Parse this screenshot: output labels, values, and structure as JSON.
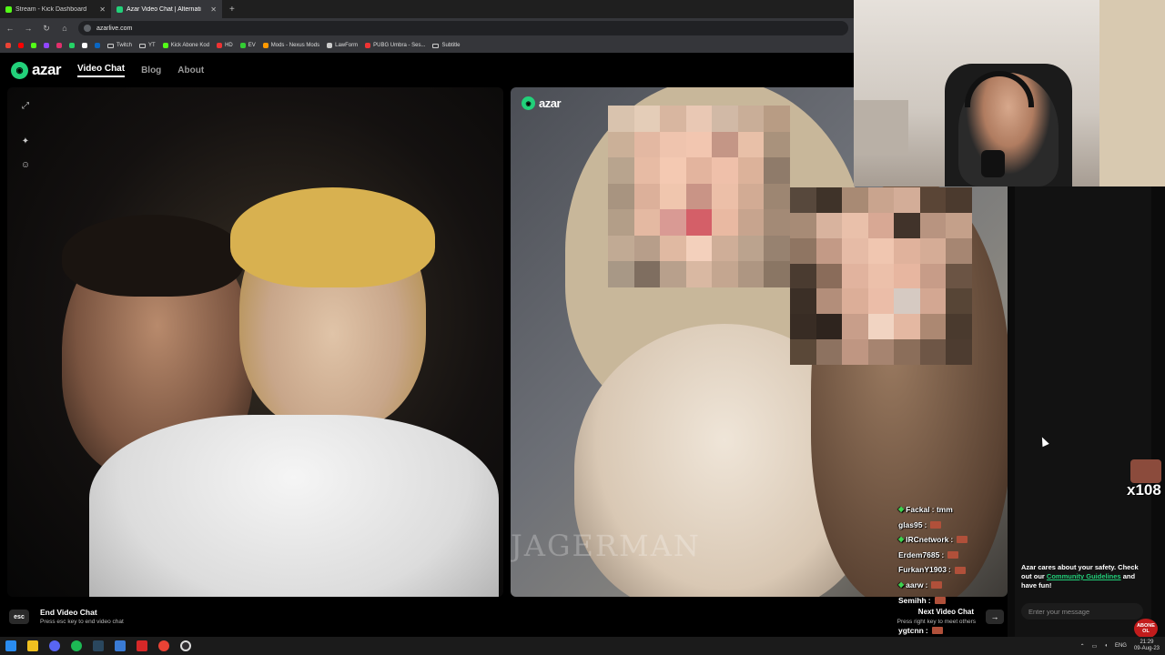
{
  "browser": {
    "tabs": [
      {
        "title": "Stream - Kick Dashboard",
        "color": "#53fc18"
      },
      {
        "title": "Azar Video Chat | Alternati",
        "color": "#22d17a"
      }
    ],
    "url": "azarlive.com",
    "bookmarks": [
      "Twitch",
      "YT",
      "Kick Abone Kod",
      "HD",
      "EV",
      "Mods - Nexus Mods",
      "LawForm",
      "PUBG Umbra - Ses...",
      "Subtitle"
    ]
  },
  "site": {
    "logo_text": "azar",
    "nav": [
      "Video Chat",
      "Blog",
      "About"
    ]
  },
  "video": {
    "watermark": "JAGERMAN"
  },
  "footer": {
    "esc_key": "esc",
    "end_title": "End Video Chat",
    "end_sub": "Press esc key to end video chat",
    "next_title": "Next Video Chat",
    "next_sub": "Press right key to meet others",
    "next_key": "→"
  },
  "chat": [
    {
      "user": "Fackal",
      "msg": ": tmm",
      "diamond": true,
      "emote": false
    },
    {
      "user": "glas95",
      "msg": ":",
      "diamond": false,
      "emote": true
    },
    {
      "user": "IRCnetwork",
      "msg": ":",
      "diamond": true,
      "emote": true
    },
    {
      "user": "Erdem7685",
      "msg": ":",
      "diamond": false,
      "emote": true
    },
    {
      "user": "FurkanY1903",
      "msg": ":",
      "diamond": false,
      "emote": true
    },
    {
      "user": "aarw",
      "msg": ":",
      "diamond": true,
      "emote": true
    },
    {
      "user": "Semihh",
      "msg": ":",
      "diamond": false,
      "emote": true
    },
    {
      "user": "",
      "msg": "",
      "diamond": false,
      "emote": false
    },
    {
      "user": "ygtcnn",
      "msg": ":",
      "diamond": false,
      "emote": true
    }
  ],
  "sidebar": {
    "safety_text": "Azar cares about your safety. Check out our ",
    "safety_link": "Community Guidelines",
    "safety_end": " and have fun!",
    "message_placeholder": "Enter your message"
  },
  "sticker": {
    "text": "x108"
  },
  "abone_badge": "ABONE OL",
  "taskbar": {
    "lang": "ENG",
    "time": "21:29",
    "date": "09-Aug-23"
  },
  "colors": {
    "accent": "#22d17a",
    "background": "#000000"
  }
}
